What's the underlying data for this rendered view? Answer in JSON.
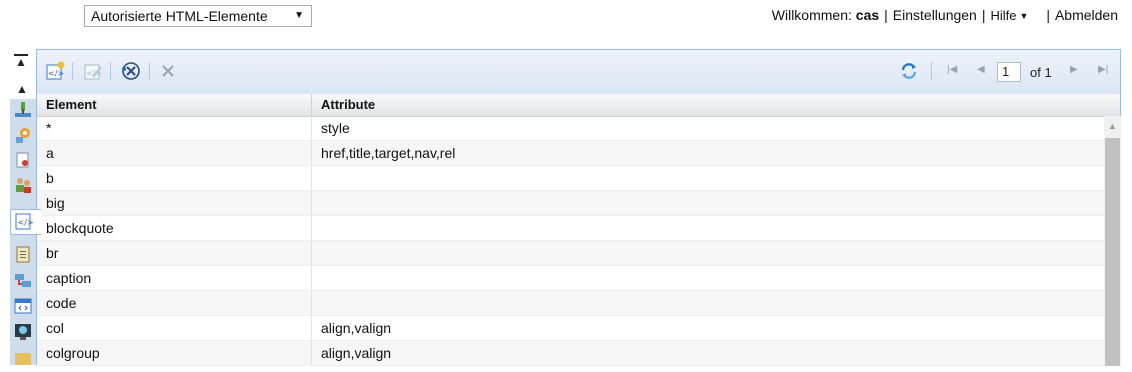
{
  "header": {
    "view_select": "Autorisierte HTML-Elemente",
    "welcome_prefix": "Willkommen:",
    "username": "cas",
    "settings": "Einstellungen",
    "help": "Hilfe",
    "logout": "Abmelden",
    "separator": "|"
  },
  "toolbar": {
    "page_value": "1",
    "page_of": "of 1"
  },
  "grid": {
    "columns": [
      "Element",
      "Attribute"
    ],
    "rows": [
      {
        "element": "*",
        "attribute": "style"
      },
      {
        "element": "a",
        "attribute": "href,title,target,nav,rel"
      },
      {
        "element": "b",
        "attribute": ""
      },
      {
        "element": "big",
        "attribute": ""
      },
      {
        "element": "blockquote",
        "attribute": ""
      },
      {
        "element": "br",
        "attribute": ""
      },
      {
        "element": "caption",
        "attribute": ""
      },
      {
        "element": "code",
        "attribute": ""
      },
      {
        "element": "col",
        "attribute": "align,valign"
      },
      {
        "element": "colgroup",
        "attribute": "align,valign"
      }
    ]
  },
  "icons": {
    "toolbar": [
      "add-element-icon",
      "edit-element-icon",
      "delete-element-icon",
      "close-icon",
      "refresh-icon",
      "first-page-icon",
      "previous-page-icon",
      "next-page-icon",
      "last-page-icon"
    ],
    "rail": [
      "network-icon",
      "gear-icon",
      "document-pin-icon",
      "users-icon",
      "html-tag-icon",
      "clipboard-icon",
      "flow-icon",
      "window-code-icon",
      "monitor-icon",
      "folder-icon"
    ]
  },
  "colors": {
    "panel_border": "#99bbe8",
    "toolbar_bg": "#dae6f4",
    "rail_bg": "#cfdcec"
  }
}
